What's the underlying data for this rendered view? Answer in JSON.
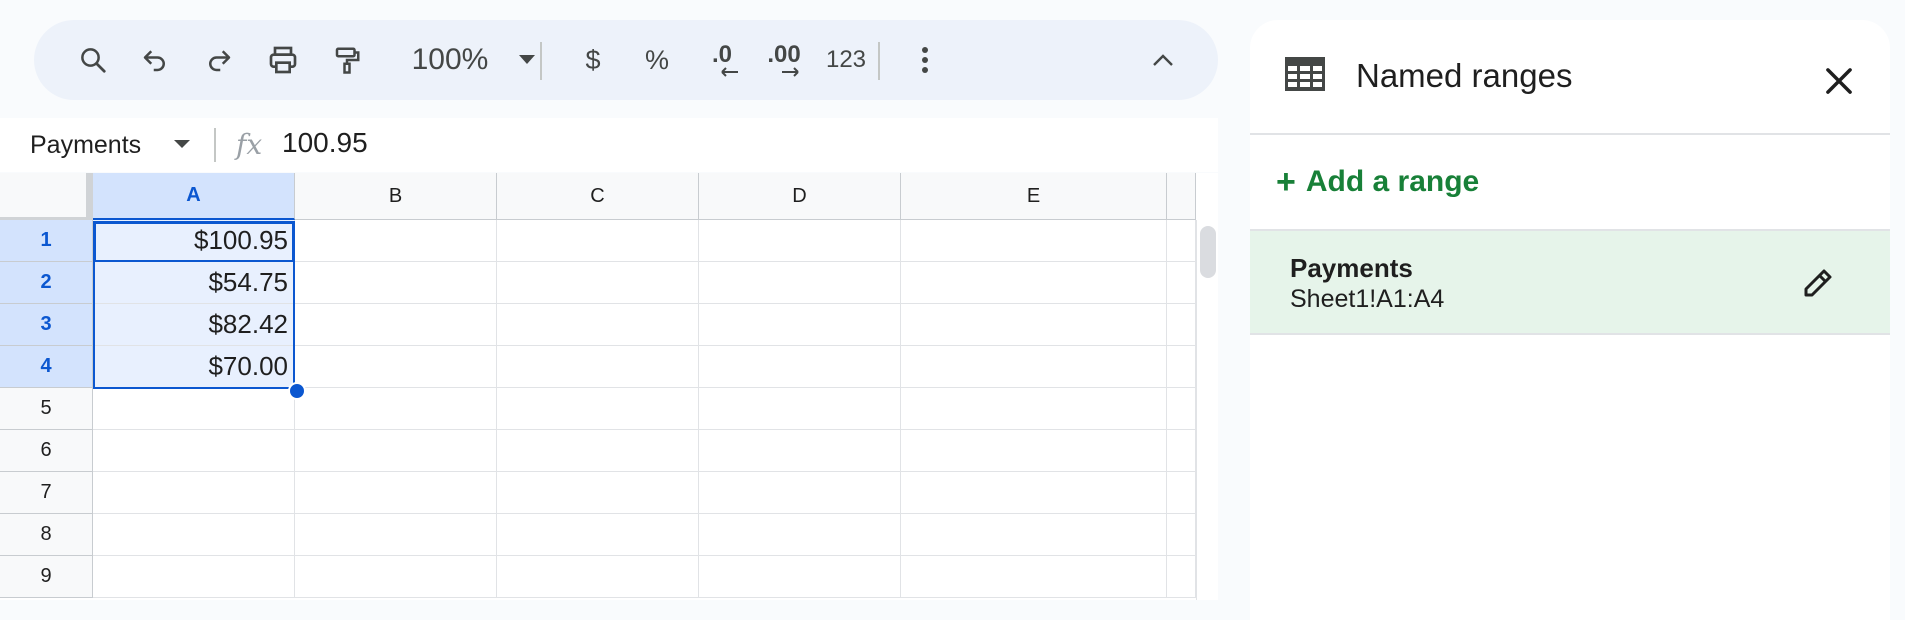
{
  "toolbar": {
    "zoom": "100%",
    "currency_label": "$",
    "percent_label": "%",
    "decrease_decimal_label": ".0",
    "increase_decimal_label": ".00",
    "format_label": "123",
    "icons": [
      "search-icon",
      "undo-icon",
      "redo-icon",
      "print-icon",
      "paint-format-icon",
      "zoom-caret-icon",
      "more-vert-icon",
      "collapse-icon"
    ]
  },
  "formula_bar": {
    "name_box": "Payments",
    "fx_label": "fx",
    "value": "100.95"
  },
  "grid": {
    "columns": [
      "A",
      "B",
      "C",
      "D",
      "E"
    ],
    "selected_column": "A",
    "rows": [
      "1",
      "2",
      "3",
      "4",
      "5",
      "6",
      "7",
      "8",
      "9"
    ],
    "selected_rows": [
      "1",
      "2",
      "3",
      "4"
    ],
    "column_a_values": [
      "$100.95",
      "$54.75",
      "$82.42",
      "$70.00",
      "",
      "",
      "",
      "",
      ""
    ]
  },
  "panel": {
    "title": "Named ranges",
    "add_label": "Add a range",
    "add_symbol": "+",
    "ranges": [
      {
        "name": "Payments",
        "ref": "Sheet1!A1:A4"
      }
    ]
  },
  "colors": {
    "accent": "#0b57d0",
    "green": "#188038",
    "selected_bg": "#e6f4ea"
  }
}
